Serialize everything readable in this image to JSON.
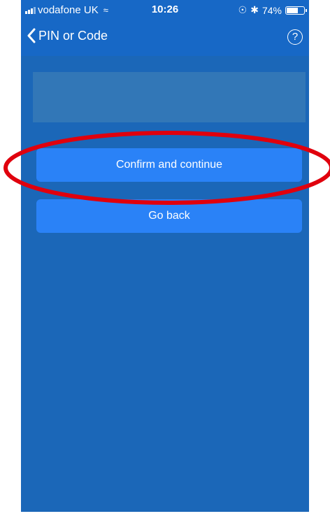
{
  "status_bar": {
    "carrier": "vodafone UK",
    "time": "10:26",
    "battery_percent": "74%",
    "battery_level": 0.74,
    "icons": [
      "signal-icon",
      "wifi-icon",
      "orientation-lock-icon",
      "bluetooth-icon",
      "battery-icon"
    ]
  },
  "nav": {
    "title": "PIN or Code",
    "help_symbol": "?"
  },
  "buttons": {
    "confirm_label": "Confirm and continue",
    "go_back_label": "Go back"
  },
  "colors": {
    "background": "#1b67b8",
    "nav_background": "#1768c6",
    "button": "#2a82f7",
    "info_box": "#3277b7",
    "highlight": "#e0000d"
  }
}
